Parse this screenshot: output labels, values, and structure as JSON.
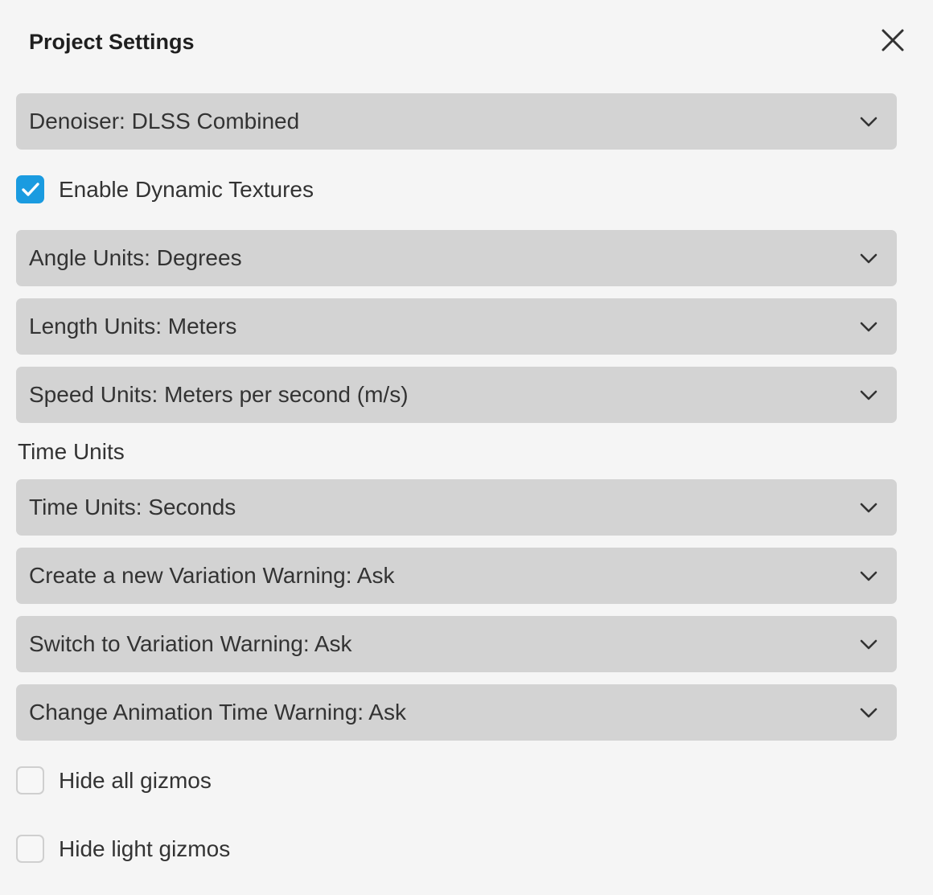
{
  "dialog": {
    "title": "Project Settings"
  },
  "dropdowns": {
    "denoiser": "Denoiser: DLSS Combined",
    "angle_units": "Angle Units: Degrees",
    "length_units": "Length Units: Meters",
    "speed_units": "Speed Units: Meters per second (m/s)",
    "time_units": "Time Units: Seconds",
    "create_variation_warning": "Create a new Variation Warning: Ask",
    "switch_variation_warning": "Switch to Variation Warning: Ask",
    "change_animation_time_warning": "Change Animation Time Warning: Ask"
  },
  "checkboxes": {
    "dynamic_textures": {
      "label": "Enable Dynamic Textures",
      "checked": true
    },
    "hide_all_gizmos": {
      "label": "Hide all gizmos",
      "checked": false
    },
    "hide_light_gizmos": {
      "label": "Hide light gizmos",
      "checked": false
    }
  },
  "sections": {
    "time_units_label": "Time Units"
  },
  "icons": {
    "close": "close-icon",
    "chevron": "chevron-down-icon",
    "check": "check-icon"
  },
  "colors": {
    "background": "#f5f5f5",
    "dropdown_bg": "#d3d3d3",
    "accent": "#1a9be0"
  }
}
